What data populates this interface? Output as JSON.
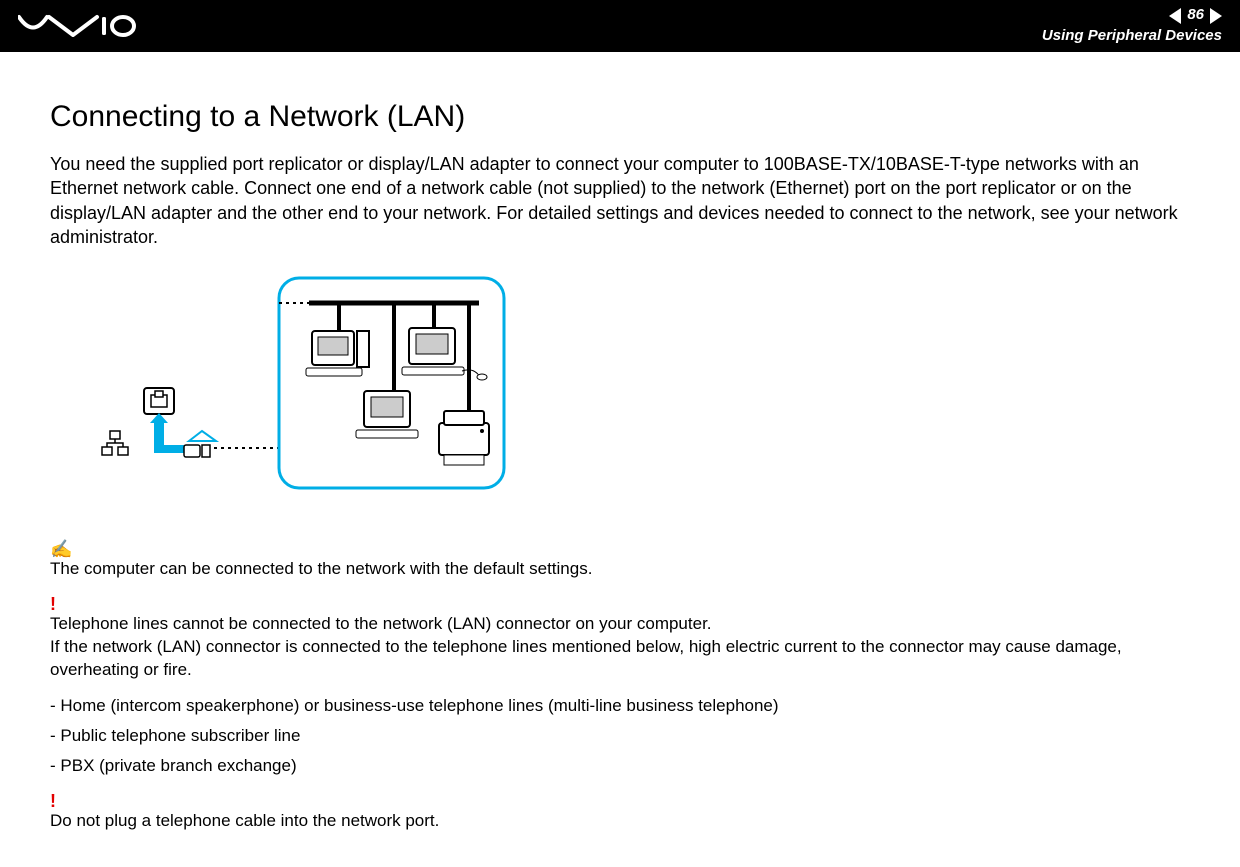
{
  "header": {
    "page_number": "86",
    "section": "Using Peripheral Devices"
  },
  "page": {
    "title": "Connecting to a Network (LAN)",
    "intro": "You need the supplied port replicator or display/LAN adapter to connect your computer to 100BASE-TX/10BASE-T-type networks with an Ethernet network cable. Connect one end of a network cable (not supplied) to the network (Ethernet) port on the port replicator or on the display/LAN adapter and the other end to your network. For detailed settings and devices needed to connect to the network, see your network administrator.",
    "note1_icon": "✍",
    "note1_text": "The computer can be connected to the network with the default settings.",
    "warn1_icon": "!",
    "warn1_line1": "Telephone lines cannot be connected to the network (LAN) connector on your computer.",
    "warn1_line2": "If the network (LAN) connector is connected to the telephone lines mentioned below, high electric current to the connector may cause damage, overheating or fire.",
    "bullets": {
      "b1": "Home (intercom speakerphone) or business-use telephone lines (multi-line business telephone)",
      "b2": "Public telephone subscriber line",
      "b3": "PBX (private branch exchange)"
    },
    "warn2_icon": "!",
    "warn2_text": "Do not plug a telephone cable into the network port."
  }
}
